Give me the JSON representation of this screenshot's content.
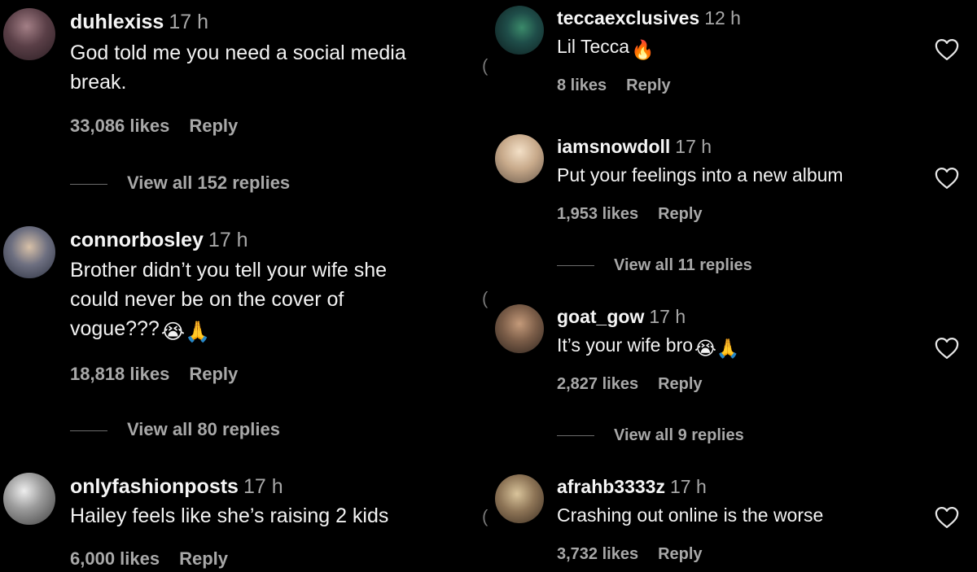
{
  "left_comments": [
    {
      "username": "duhlexiss",
      "time": "17 h",
      "text_line1": "God told me you need a social media",
      "text_line2": "break.",
      "likes": "33,086 likes",
      "reply_label": "Reply",
      "view_replies": "View all 152 replies"
    },
    {
      "username": "connorbosley",
      "time": "17 h",
      "text_line1": "Brother didn’t you tell your wife she",
      "text_line2": "could never be on the cover of",
      "text_line3": "vogue???",
      "emojis": "😭🙏",
      "likes": "18,818 likes",
      "reply_label": "Reply",
      "view_replies": "View all 80 replies"
    },
    {
      "username": "onlyfashionposts",
      "time": "17 h",
      "text_line1": "Hailey feels like she’s raising 2 kids",
      "likes": "6,000 likes",
      "reply_label": "Reply"
    }
  ],
  "right_comments": [
    {
      "username": "teccaexclusives",
      "time": "12 h",
      "text_line1": "Lil Tecca",
      "emojis": "🔥",
      "likes": "8 likes",
      "reply_label": "Reply"
    },
    {
      "username": "iamsnowdoll",
      "time": "17 h",
      "text_line1": "Put your feelings into a new album",
      "likes": "1,953 likes",
      "reply_label": "Reply",
      "view_replies": "View all 11 replies"
    },
    {
      "username": "goat_gow",
      "time": "17 h",
      "text_line1": "It’s your wife bro",
      "emojis": "😭🙏",
      "likes": "2,827 likes",
      "reply_label": "Reply",
      "view_replies": "View all 9 replies"
    },
    {
      "username": "afrahb3333z",
      "time": "17 h",
      "text_line1": "Crashing out online is the worse",
      "likes": "3,732 likes",
      "reply_label": "Reply"
    }
  ],
  "icons": {
    "like": "heart-outline-icon"
  },
  "colors": {
    "background": "#000000",
    "primary_text": "#f2f2f2",
    "secondary_text": "#a8a8a8"
  }
}
